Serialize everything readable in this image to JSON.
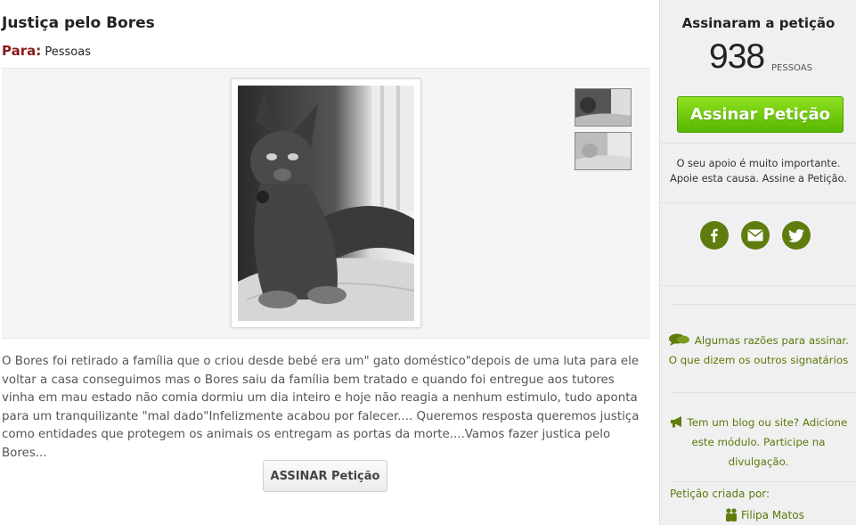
{
  "petition": {
    "title": "Justiça pelo Bores",
    "to_label": "Para:",
    "to_value": "Pessoas",
    "description": "O Bores foi retirado a família que o criou desde bebé era um\" gato doméstico\"depois de uma luta para ele voltar a casa conseguimos mas o Bores saiu da família bem tratado e quando foi entregue aos tutores vinha em mau estado não comia dormiu um dia inteiro e hoje não reagia a nenhum estimulo, tudo aponta para um tranquilizante \"mal dado\"Infelizmente acabou por falecer.... Queremos resposta queremos justiça como entidades que protegem os animais os entregam as portas da morte....Vamos fazer justica pelo Bores...",
    "sign_button": "ASSINAR Petição"
  },
  "sidebar": {
    "signed_heading": "Assinaram a petição",
    "count": "938",
    "count_unit": "PESSOAS",
    "sign_button": "Assinar Petição",
    "support_line1": "O seu apoio é muito importante.",
    "support_line2": "Apoie esta causa. Assine a Petição.",
    "reasons_line1": "Algumas razões para assinar.",
    "reasons_line2": "O que dizem os outros signatários",
    "blog_line1": "Tem um blog ou site? Adicione",
    "blog_line2": "este módulo. Participe na divulgação.",
    "created_by_label": "Petição criada por:",
    "author": "Filipa Matos"
  },
  "icons": {
    "social": [
      "facebook-icon",
      "email-icon",
      "twitter-icon"
    ],
    "reasons": "chat-bubbles-icon",
    "blog": "megaphone-icon",
    "author": "people-icon"
  },
  "colors": {
    "accent_green": "#5e7d0e",
    "button_green": "#6cc80c",
    "para_label": "#8b1a1a"
  }
}
